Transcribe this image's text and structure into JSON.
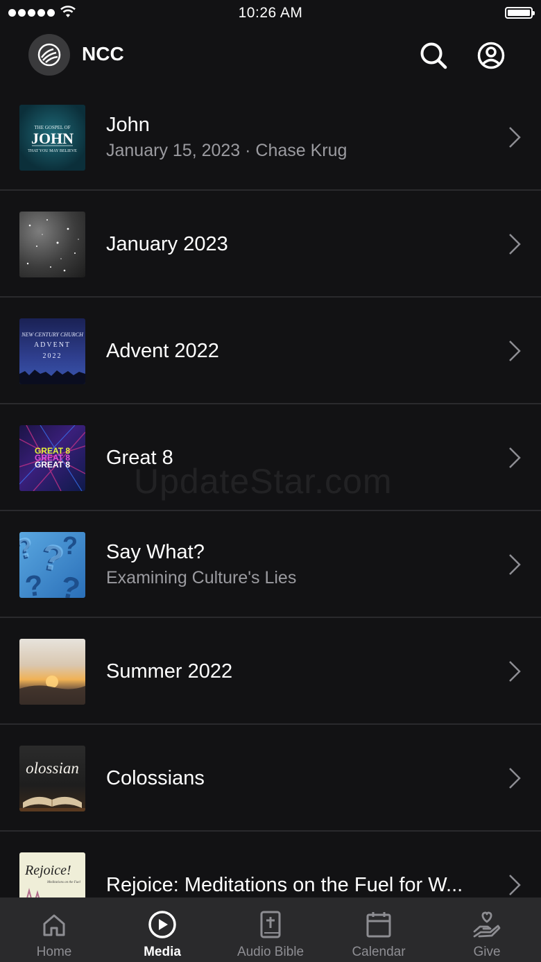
{
  "status_bar": {
    "time": "10:26 AM"
  },
  "header": {
    "title": "NCC"
  },
  "series_list": [
    {
      "title": "John",
      "subtitle": "January 15, 2023 · Chase Krug"
    },
    {
      "title": "January 2023",
      "subtitle": ""
    },
    {
      "title": "Advent 2022",
      "subtitle": ""
    },
    {
      "title": "Great 8",
      "subtitle": ""
    },
    {
      "title": "Say What?",
      "subtitle": "Examining Culture's Lies"
    },
    {
      "title": "Summer 2022",
      "subtitle": ""
    },
    {
      "title": "Colossians",
      "subtitle": ""
    },
    {
      "title": "Rejoice: Meditations on the Fuel for W...",
      "subtitle": ""
    }
  ],
  "thumbnails": {
    "john": {
      "line1": "THE GOSPEL OF",
      "line2": "JOHN",
      "line3": "THAT YOU MAY BELIEVE"
    },
    "advent": {
      "line1": "NEW CENTURY CHURCH",
      "line2": "ADVENT",
      "line3": "2022"
    },
    "great8": {
      "line1": "GREAT 8",
      "line2": "GREAT 8",
      "line3": "GREAT 8"
    },
    "colossians": {
      "text": "olossian"
    },
    "rejoice": {
      "text": "Rejoice!",
      "sub": "Meditations on the Fuel"
    }
  },
  "watermark": "UpdateStar.com",
  "tab_bar": {
    "tabs": [
      {
        "label": "Home",
        "icon": "home-icon"
      },
      {
        "label": "Media",
        "icon": "play-circle-icon",
        "active": true
      },
      {
        "label": "Audio Bible",
        "icon": "bible-icon"
      },
      {
        "label": "Calendar",
        "icon": "calendar-icon"
      },
      {
        "label": "Give",
        "icon": "give-icon"
      }
    ]
  },
  "colors": {
    "background": "#121214",
    "tab_bar": "#2a2a2c",
    "secondary_text": "#9b9ba0",
    "inactive_tab": "#8e8e93"
  }
}
